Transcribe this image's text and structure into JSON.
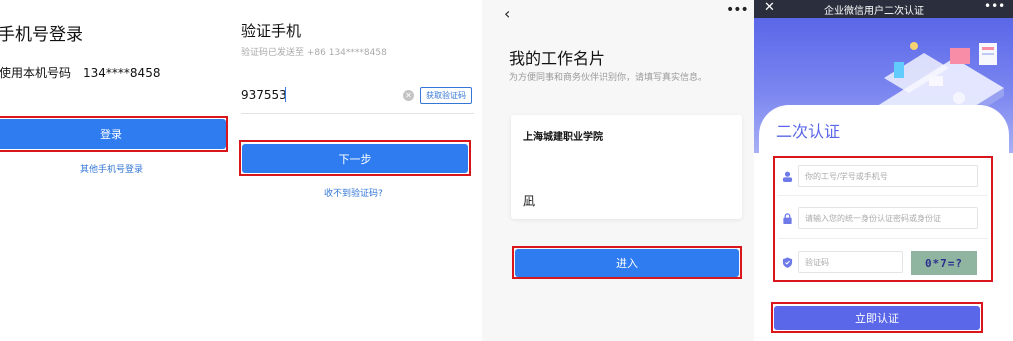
{
  "panel1": {
    "title": "手机号登录",
    "phone_label": "使用本机号码",
    "phone_number": "134****8458",
    "login_button": "登录",
    "other_login_link": "其他手机号登录"
  },
  "panel2": {
    "title": "验证手机",
    "subtitle": "验证码已发送至 +86 134****8458",
    "code_value": "937553",
    "get_code_button": "获取验证码",
    "next_button": "下一步",
    "not_received_link": "收不到验证码?"
  },
  "panel3": {
    "title": "我的工作名片",
    "subtitle": "为方便同事和商务伙伴识别你，请填写真实信息。",
    "organization": "上海城建职业学院",
    "name": "凪",
    "enter_button": "进入"
  },
  "panel4": {
    "topbar_title": "企业微信用户二次认证",
    "heading": "二次认证",
    "id_placeholder": "你的工号/学号或手机号",
    "password_placeholder": "请输入您的统一身份认证密码或身份证",
    "captcha_placeholder": "验证码",
    "captcha_text": "0*7=?",
    "submit_button": "立即认证"
  },
  "colors": {
    "primary_blue": "#2f7cf0",
    "highlight_red": "#d9161c",
    "auth_purple": "#5a67e8",
    "link_blue": "#3477d6"
  },
  "icons": [
    "back-icon",
    "more-icon",
    "close-icon",
    "clear-icon",
    "user-icon",
    "lock-icon",
    "shield-icon"
  ]
}
